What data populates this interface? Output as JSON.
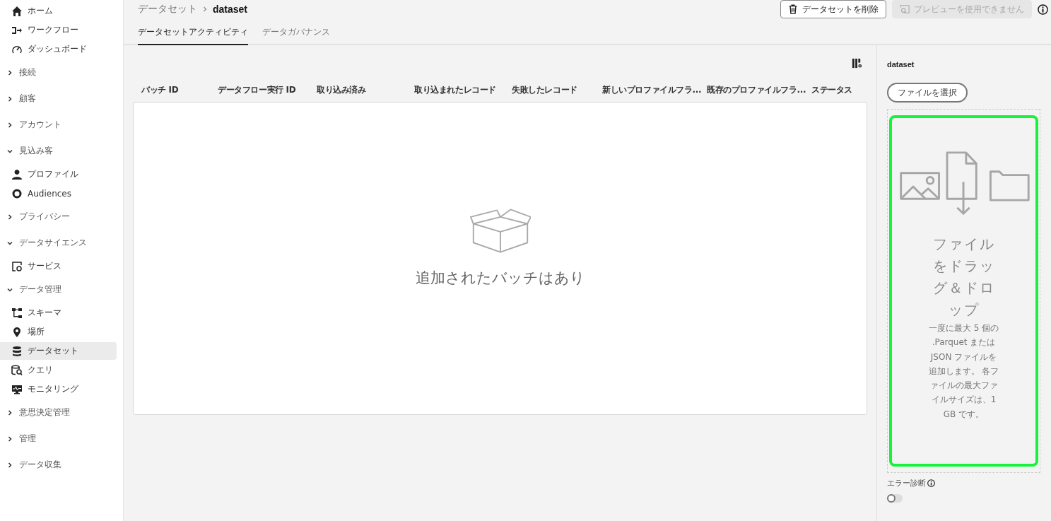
{
  "sidebar": {
    "items": [
      {
        "kind": "link",
        "label": "ホーム",
        "selected": false
      },
      {
        "kind": "link",
        "label": "ワークフロー",
        "selected": false
      },
      {
        "kind": "link",
        "label": "ダッシュボード",
        "selected": false
      },
      {
        "kind": "group",
        "label": "接続",
        "expanded": false
      },
      {
        "kind": "group",
        "label": "顧客",
        "expanded": false
      },
      {
        "kind": "group",
        "label": "アカウント",
        "expanded": false
      },
      {
        "kind": "group",
        "label": "見込み客",
        "expanded": true,
        "children": [
          {
            "kind": "link",
            "label": "プロファイル",
            "selected": false
          },
          {
            "kind": "link",
            "label": "Audiences",
            "selected": false
          }
        ]
      },
      {
        "kind": "group",
        "label": "プライバシー",
        "expanded": false
      },
      {
        "kind": "group",
        "label": "データサイエンス",
        "expanded": true,
        "children": [
          {
            "kind": "link",
            "label": "サービス",
            "selected": false
          }
        ]
      },
      {
        "kind": "group",
        "label": "データ管理",
        "expanded": true,
        "children": [
          {
            "kind": "link",
            "label": "スキーマ",
            "selected": false
          },
          {
            "kind": "link",
            "label": "場所",
            "selected": false
          },
          {
            "kind": "link",
            "label": "データセット",
            "selected": true
          },
          {
            "kind": "link",
            "label": "クエリ",
            "selected": false
          },
          {
            "kind": "link",
            "label": "モニタリング",
            "selected": false
          }
        ]
      },
      {
        "kind": "group",
        "label": "意思決定管理",
        "expanded": false
      },
      {
        "kind": "group",
        "label": "管理",
        "expanded": false
      },
      {
        "kind": "group",
        "label": "データ収集",
        "expanded": false
      }
    ]
  },
  "breadcrumb": [
    "データセット",
    "dataset"
  ],
  "actions": [
    {
      "label": "データセットを削除",
      "disabled": false
    },
    {
      "label": "プレビューを使用できません",
      "disabled": true
    }
  ],
  "tabs": [
    {
      "label": "データセットアクティビティ",
      "selected": true
    },
    {
      "label": "データガバナンス",
      "selected": false
    }
  ],
  "table": {
    "columns": [
      "バッチ ID",
      "データフロー実行 ID",
      "取り込み済み",
      "取り込まれたレコード",
      "失敗したレコード",
      "新しいプロファイルフラ...",
      "既存のプロファイルフラ...",
      "ステータス"
    ],
    "empty_message": "追加されたバッチはあり"
  },
  "panel": {
    "title": "dataset",
    "choose_button": "ファイルを選択",
    "drop_title": "ファイルをドラッグ＆ドロップ",
    "drop_hint": "一度に最大 5 個の .Parquet または JSON ファイルを追加します。 各ファイルの最大ファイルサイズは、1 GB です。",
    "highlighted": true,
    "error_diagnostics": {
      "label": "エラー診断",
      "on": false
    }
  }
}
